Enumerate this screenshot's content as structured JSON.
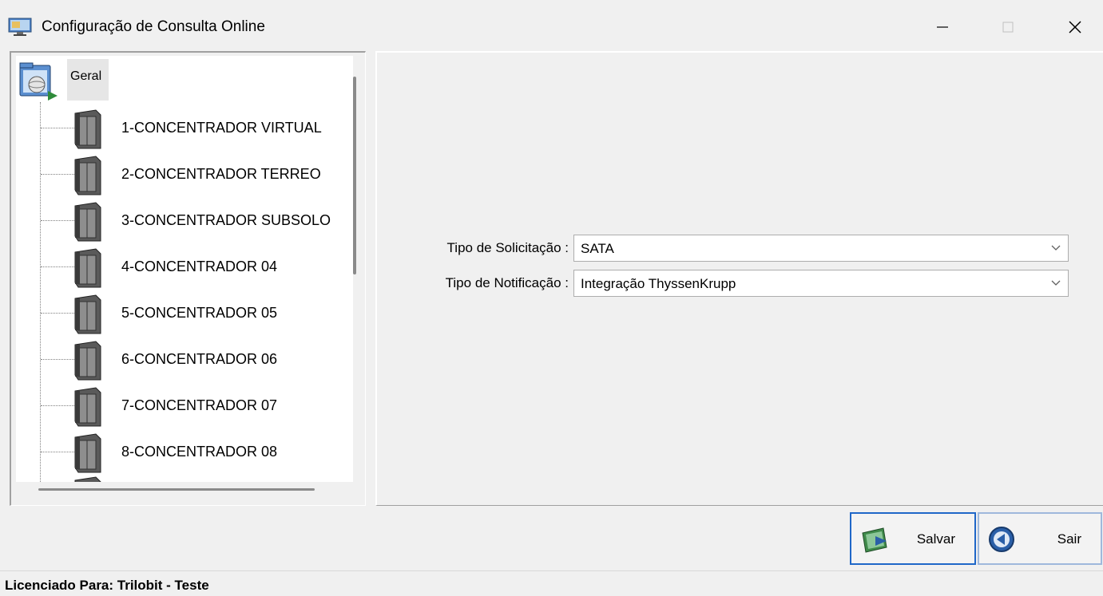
{
  "window": {
    "title": "Configuração de Consulta Online",
    "minimize_icon": "minimize-icon",
    "maximize_icon": "maximize-icon",
    "close_icon": "close-icon"
  },
  "tree": {
    "root": {
      "label": "Geral",
      "icon": "network-folder-icon"
    },
    "items": [
      {
        "label": "1-CONCENTRADOR VIRTUAL",
        "icon": "server-icon"
      },
      {
        "label": "2-CONCENTRADOR TERREO",
        "icon": "server-icon"
      },
      {
        "label": "3-CONCENTRADOR SUBSOLO",
        "icon": "server-icon"
      },
      {
        "label": "4-CONCENTRADOR 04",
        "icon": "server-icon"
      },
      {
        "label": "5-CONCENTRADOR 05",
        "icon": "server-icon"
      },
      {
        "label": "6-CONCENTRADOR 06",
        "icon": "server-icon"
      },
      {
        "label": "7-CONCENTRADOR 07",
        "icon": "server-icon"
      },
      {
        "label": "8-CONCENTRADOR 08",
        "icon": "server-icon"
      }
    ]
  },
  "form": {
    "request_type": {
      "label": "Tipo de Solicitação :",
      "value": "SATA"
    },
    "notification_type": {
      "label": "Tipo de Notificação :",
      "value": "Integração ThyssenKrupp"
    }
  },
  "buttons": {
    "save": {
      "label": "Salvar",
      "icon": "save-icon"
    },
    "exit": {
      "label": "Sair",
      "icon": "exit-icon"
    }
  },
  "status": {
    "text": "Licenciado Para: Trilobit - Teste"
  },
  "colors": {
    "accent": "#1f67c8",
    "window_bg": "#f0f0f0"
  }
}
